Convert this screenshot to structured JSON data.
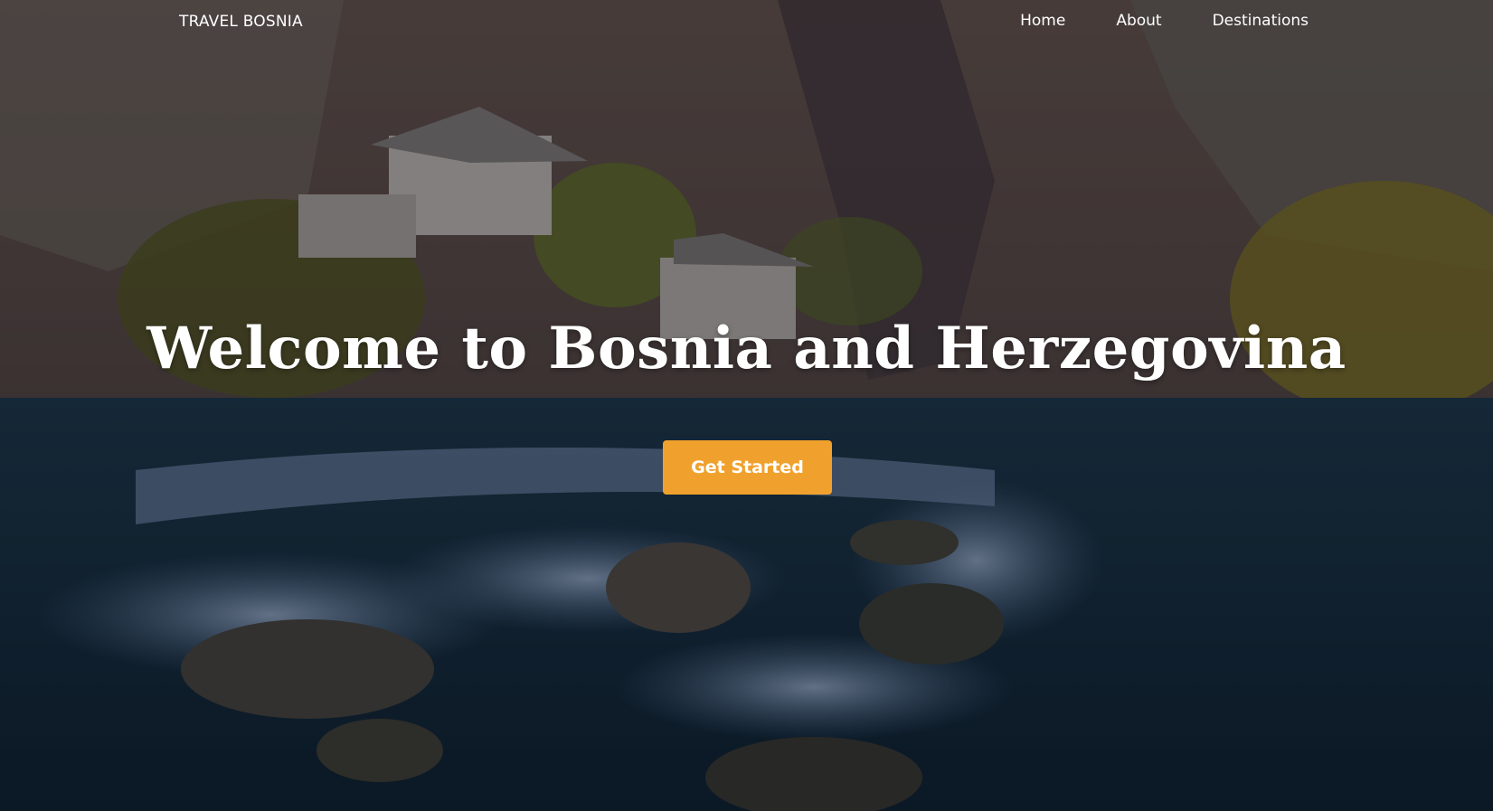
{
  "nav": {
    "brand": "TRAVEL BOSNIA",
    "links": [
      "Home",
      "About",
      "Destinations"
    ]
  },
  "hero": {
    "headline": "Welcome to Bosnia and Herzegovina",
    "cta_label": "Get Started",
    "background": "photo of river waterfalls below stone houses and a cliff"
  },
  "colors": {
    "accent": "#f0a12d",
    "text": "#ffffff"
  }
}
